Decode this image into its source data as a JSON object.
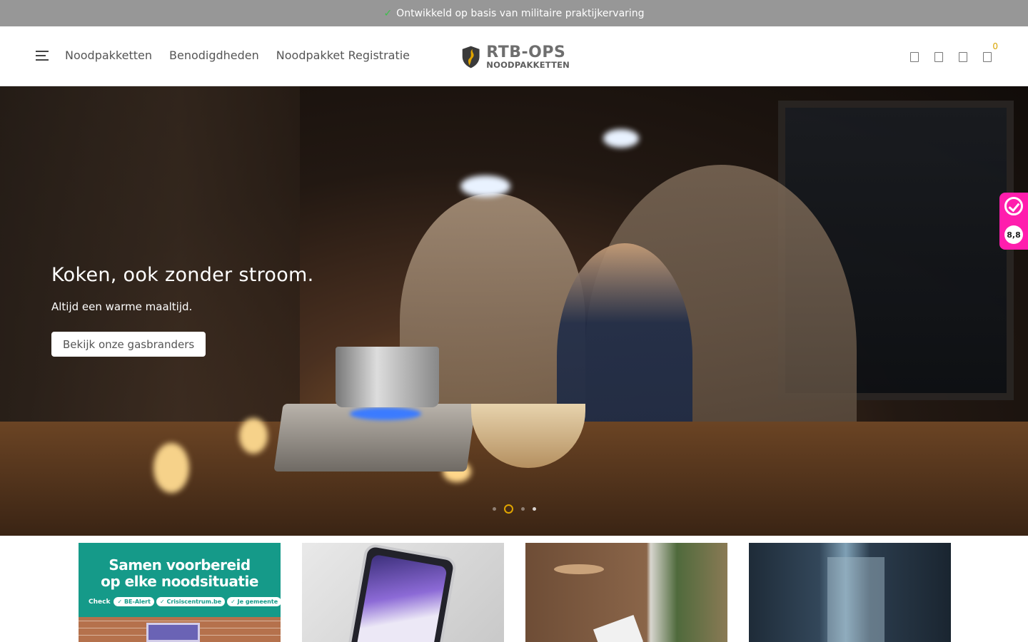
{
  "topbar": {
    "check": "✓",
    "text": "Ontwikkeld op basis van militaire praktijkervaring"
  },
  "nav": {
    "items": [
      "Noodpakketten",
      "Benodigdheden",
      "Noodpakket Registratie"
    ]
  },
  "logo": {
    "line1": "RTB-OPS",
    "line2": "NOODPAKKETTEN",
    "shield_color": "#3a3a3a",
    "accent": "#e0a400"
  },
  "header_icons": [
    "search-icon",
    "account-icon",
    "wishlist-icon",
    "cart-icon"
  ],
  "cart": {
    "count": "0"
  },
  "hero": {
    "title": "Koken, ook zonder stroom.",
    "subtitle": "Altijd een warme maaltijd.",
    "button": "Bekijk onze gasbranders",
    "slides": 4,
    "active_slide": 2
  },
  "kiyoh": {
    "score": "8,8",
    "color": "#ff1dad"
  },
  "tiles": {
    "t1": {
      "heading1": "Samen voorbereid",
      "heading2": "op elke noodsituatie",
      "check_label": "Check",
      "pills": [
        "BE-Alert",
        "Crisiscentrum.be",
        "Je gemeente"
      ]
    }
  }
}
